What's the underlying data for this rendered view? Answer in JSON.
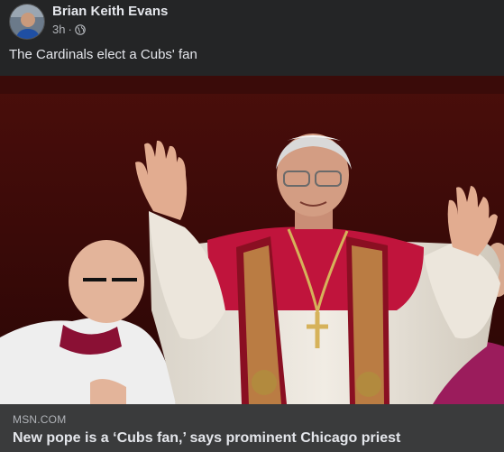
{
  "post": {
    "author": "Brian Keith Evans",
    "timestamp": "3h",
    "privacy_icon": "globe-icon",
    "caption": "The Cardinals elect a Cubs' fan"
  },
  "link": {
    "domain": "MSN.COM",
    "headline": "New pope is a ‘Cubs fan,’ says prominent Chicago priest"
  },
  "colors": {
    "background": "#242526",
    "link_card": "#3a3b3c",
    "text_primary": "#e4e6eb",
    "text_secondary": "#b0b3b8",
    "vestment_red": "#c0143c"
  }
}
